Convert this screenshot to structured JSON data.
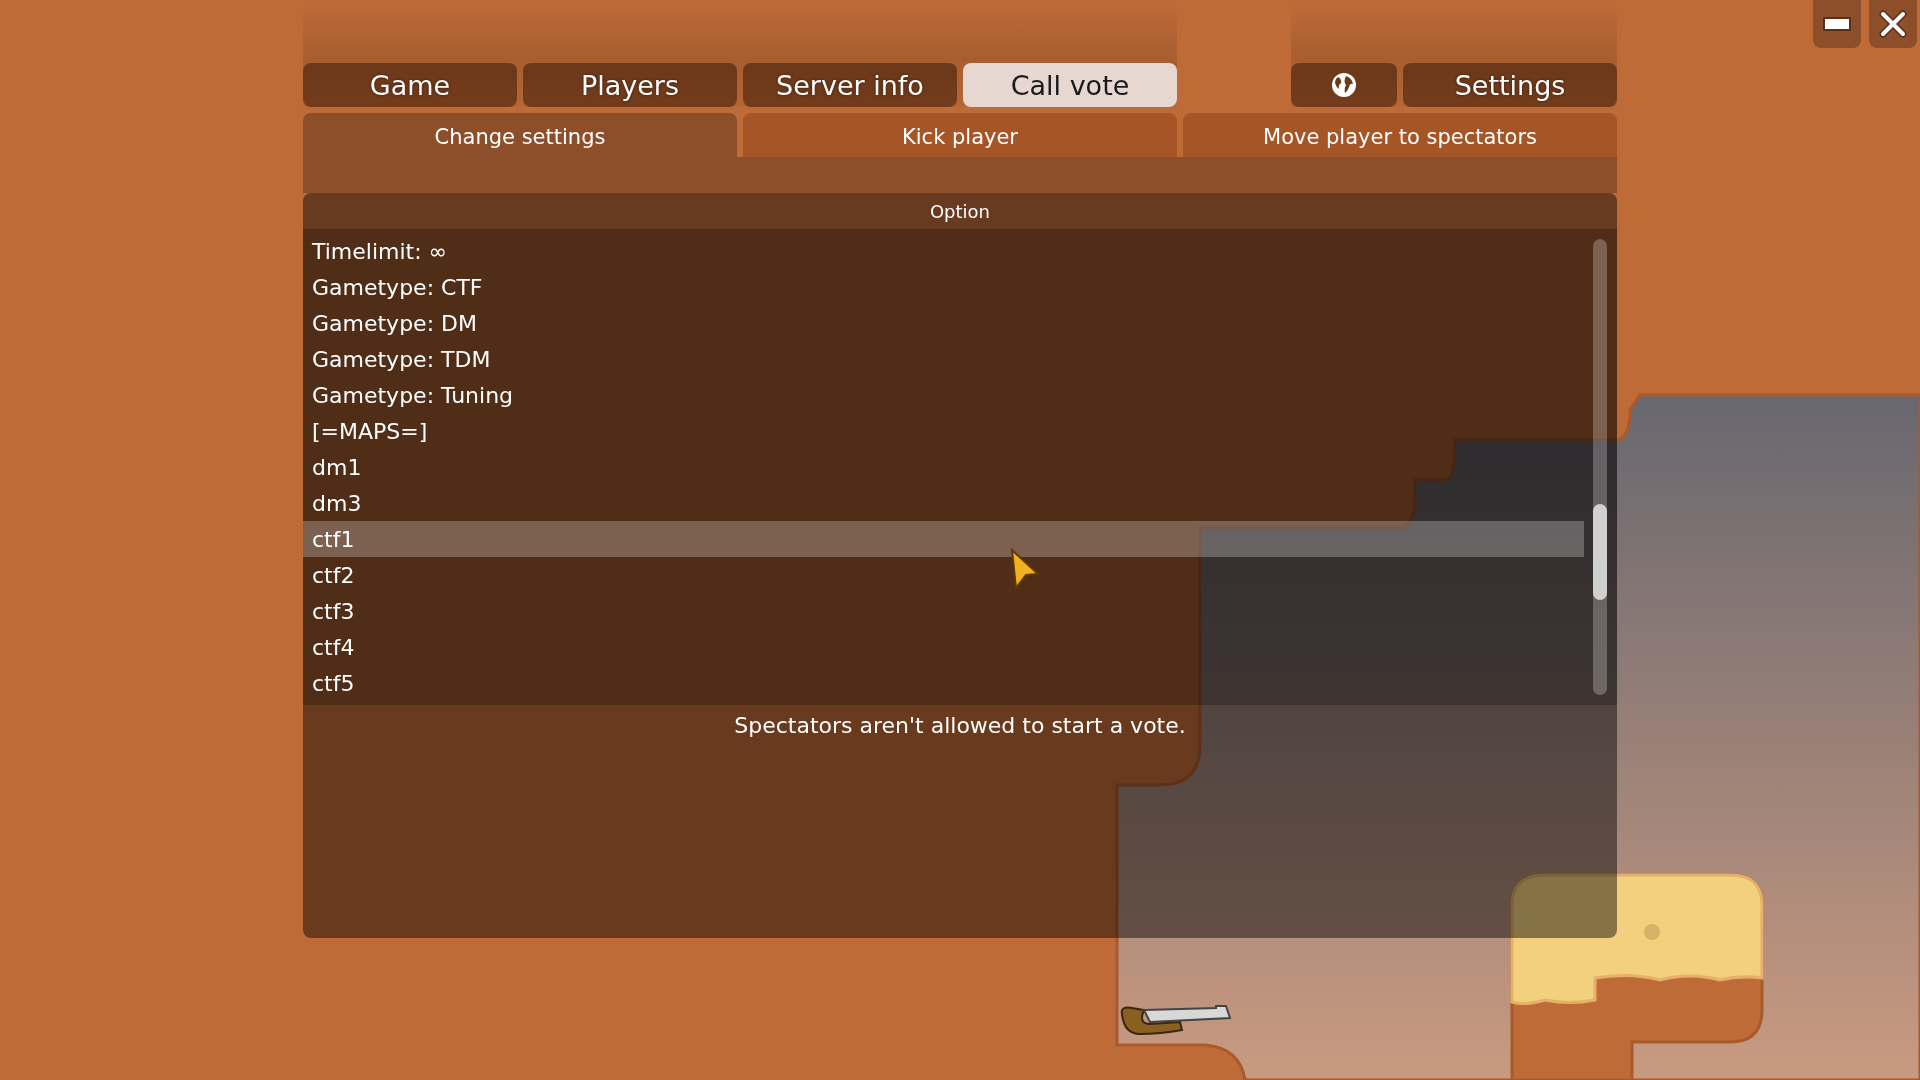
{
  "main_tabs": [
    {
      "label": "Game",
      "selected": false
    },
    {
      "label": "Players",
      "selected": false
    },
    {
      "label": "Server info",
      "selected": false
    },
    {
      "label": "Call vote",
      "selected": true
    }
  ],
  "settings_tabs": [
    {
      "kind": "icon",
      "selected": false
    },
    {
      "kind": "text",
      "label": "Settings",
      "selected": false
    }
  ],
  "vote_tabs": [
    {
      "label": "Change settings",
      "selected": true
    },
    {
      "label": "Kick player",
      "selected": false
    },
    {
      "label": "Move player to spectators",
      "selected": false
    }
  ],
  "option_list": {
    "column": "Option",
    "rows": [
      {
        "label": "Timelimit: ∞",
        "selected": false
      },
      {
        "label": "Gametype: CTF",
        "selected": false
      },
      {
        "label": "Gametype: DM",
        "selected": false
      },
      {
        "label": "Gametype: TDM",
        "selected": false
      },
      {
        "label": "Gametype: Tuning",
        "selected": false
      },
      {
        "label": "[=MAPS=]",
        "selected": false
      },
      {
        "label": "dm1",
        "selected": false
      },
      {
        "label": "dm3",
        "selected": false
      },
      {
        "label": "ctf1",
        "selected": true
      },
      {
        "label": "ctf2",
        "selected": false
      },
      {
        "label": "ctf3",
        "selected": false
      },
      {
        "label": "ctf4",
        "selected": false
      },
      {
        "label": "ctf5",
        "selected": false
      }
    ]
  },
  "message": "Spectators aren't allowed to start a vote."
}
